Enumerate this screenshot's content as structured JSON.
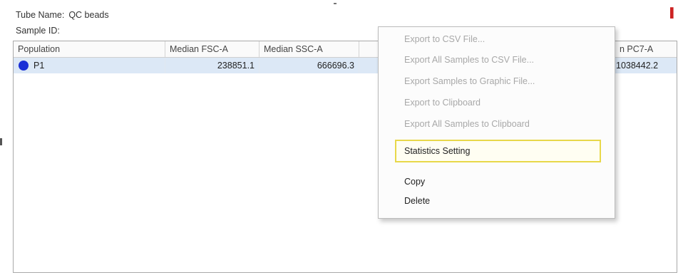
{
  "info": {
    "tube_label": "Tube Name:",
    "tube_value": "QC beads",
    "sample_label": "Sample ID:",
    "sample_value": ""
  },
  "table": {
    "columns": [
      "Population",
      "Median FSC-A",
      "Median SSC-A",
      "n PC7-A"
    ],
    "rows": [
      {
        "population": "P1",
        "dot_color": "#1a2fd6",
        "median_fsc_a": "238851.1",
        "median_ssc_a": "666696.3",
        "pc7_a": "1038442.2"
      }
    ]
  },
  "context_menu": {
    "items": [
      {
        "label": "Export to CSV File...",
        "enabled": false
      },
      {
        "label": "Export All Samples to CSV File...",
        "enabled": false
      },
      {
        "label": "Export Samples to Graphic File...",
        "enabled": false
      },
      {
        "label": "Export to Clipboard",
        "enabled": false
      },
      {
        "label": "Export All Samples to Clipboard",
        "enabled": false
      },
      {
        "label": "Statistics Setting",
        "enabled": true,
        "highlighted": true
      },
      {
        "label": "Copy",
        "enabled": true
      },
      {
        "label": "Delete",
        "enabled": true
      }
    ]
  },
  "colors": {
    "selection_row": "#dce8f6",
    "highlight_border": "#e8d84a",
    "population_dot": "#1a2fd6"
  }
}
